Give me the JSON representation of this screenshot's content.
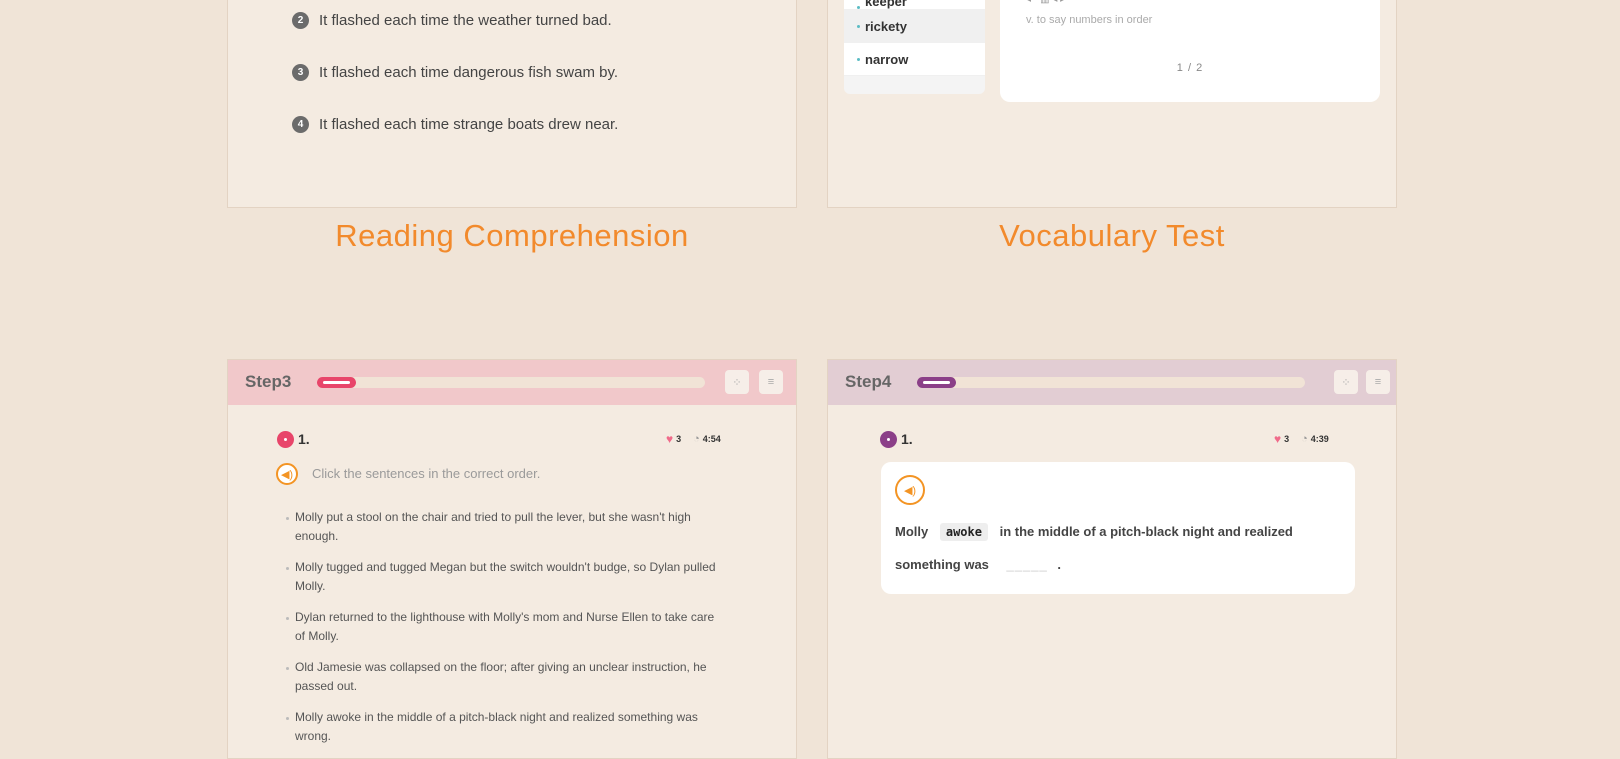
{
  "reading_panel": {
    "options": [
      {
        "number": "2",
        "text": "It flashed each time the weather turned bad."
      },
      {
        "number": "3",
        "text": "It flashed each time dangerous fish swam by."
      },
      {
        "number": "4",
        "text": "It flashed each time strange boats drew near."
      }
    ],
    "caption": "Reading Comprehension"
  },
  "vocab_panel": {
    "word_list": [
      "keeper",
      "rickety",
      "narrow"
    ],
    "selected_word": "rickety",
    "definition": "v. to say numbers in order",
    "pager": "1  / 2",
    "caption": "Vocabulary Test"
  },
  "step3": {
    "label": "Step3",
    "progress": 0.1,
    "question_number": "1.",
    "hearts": "3",
    "timer": "4:54",
    "instruction": "Click the sentences in the correct order.",
    "sentences": [
      "Molly put a stool on the chair and tried to pull the lever, but she wasn't high enough.",
      "Molly tugged and tugged Megan but the switch wouldn't budge, so Dylan pulled Molly.",
      "Dylan returned to the lighthouse with Molly's mom and Nurse Ellen to take care of Molly.",
      "Old Jamesie was collapsed on the floor; after giving an unclear instruction, he passed out.",
      "Molly awoke in the middle of a pitch-black night and realized something was wrong."
    ],
    "colors": {
      "accent": "#e8456a",
      "header": "#f1c8ca"
    }
  },
  "step4": {
    "label": "Step4",
    "progress": 0.1,
    "question_number": "1.",
    "hearts": "3",
    "timer": "4:39",
    "sentence_start": "Molly",
    "chosen_word": "awoke",
    "sentence_middle": "in the middle of a pitch-black night and realized",
    "sentence_line2": "something was",
    "blank": "_____",
    "sentence_end": ".",
    "colors": {
      "accent": "#8b3f88",
      "header": "#e2cdd3"
    }
  }
}
